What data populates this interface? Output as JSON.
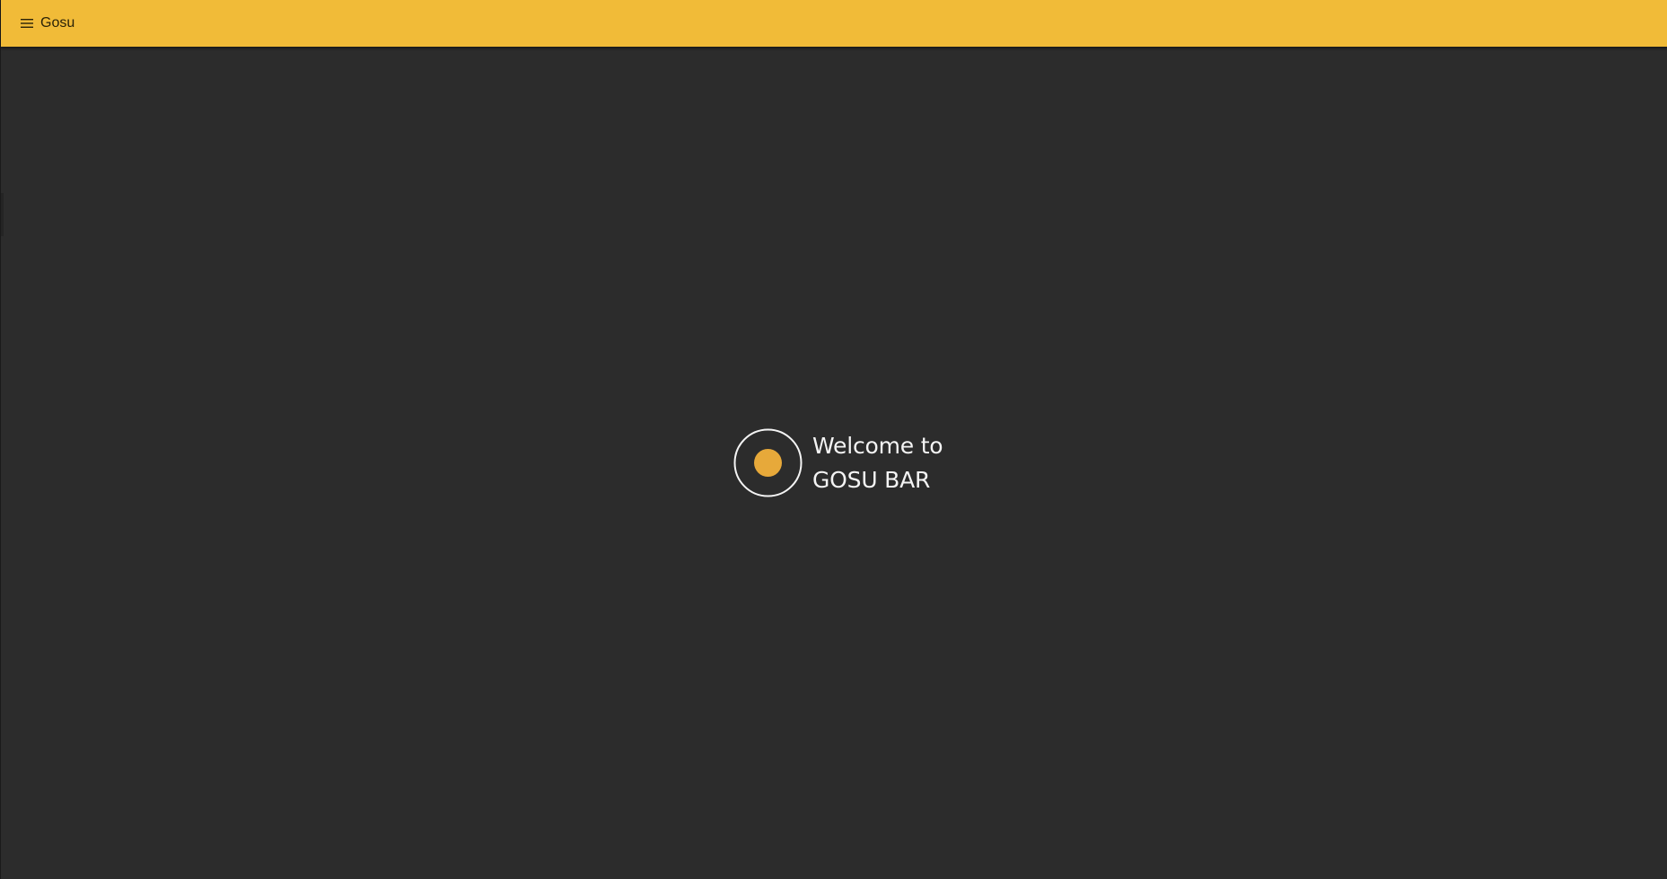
{
  "header": {
    "title": "Gosu",
    "menu_icon": "hamburger-menu-icon",
    "background_color": "#f1bb38"
  },
  "main": {
    "background_color": "#2c2c2c",
    "welcome": {
      "line1": "Welcome to",
      "line2": "GOSU BAR",
      "logo_icon": "gosu-logo-icon",
      "accent_color": "#e7a93a"
    }
  }
}
